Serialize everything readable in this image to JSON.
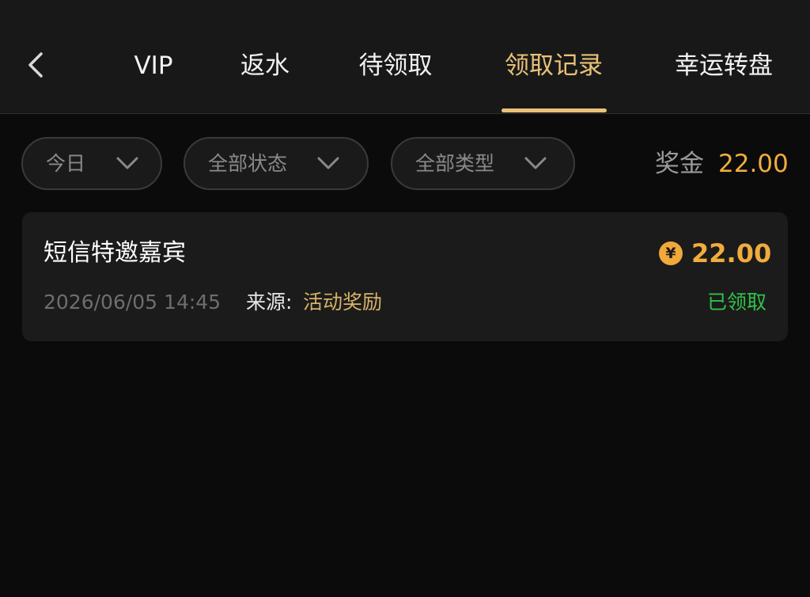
{
  "header": {
    "tabs": [
      {
        "label": "VIP",
        "active": false
      },
      {
        "label": "返水",
        "active": false
      },
      {
        "label": "待领取",
        "active": false
      },
      {
        "label": "领取记录",
        "active": true
      },
      {
        "label": "幸运转盘",
        "active": false
      }
    ]
  },
  "filters": {
    "date": {
      "label": "今日"
    },
    "status": {
      "label": "全部状态"
    },
    "type": {
      "label": "全部类型"
    }
  },
  "bonus": {
    "label": "奖金",
    "amount": "22.00"
  },
  "records": [
    {
      "title": "短信特邀嘉宾",
      "coin_symbol": "¥",
      "amount": "22.00",
      "datetime": "2026/06/05 14:45",
      "source_label": "来源:",
      "source_value": "活动奖励",
      "status": "已领取"
    }
  ],
  "colors": {
    "background": "#0b0b0b",
    "header": "#181818",
    "accent_gold": "#e9c178",
    "amount_orange": "#f0ad3c",
    "status_green": "#2fc24a",
    "card": "#1b1b1b"
  },
  "icons": {
    "back": "chevron-left-icon",
    "dropdown": "chevron-down-icon",
    "coin": "yuan-coin-icon"
  }
}
